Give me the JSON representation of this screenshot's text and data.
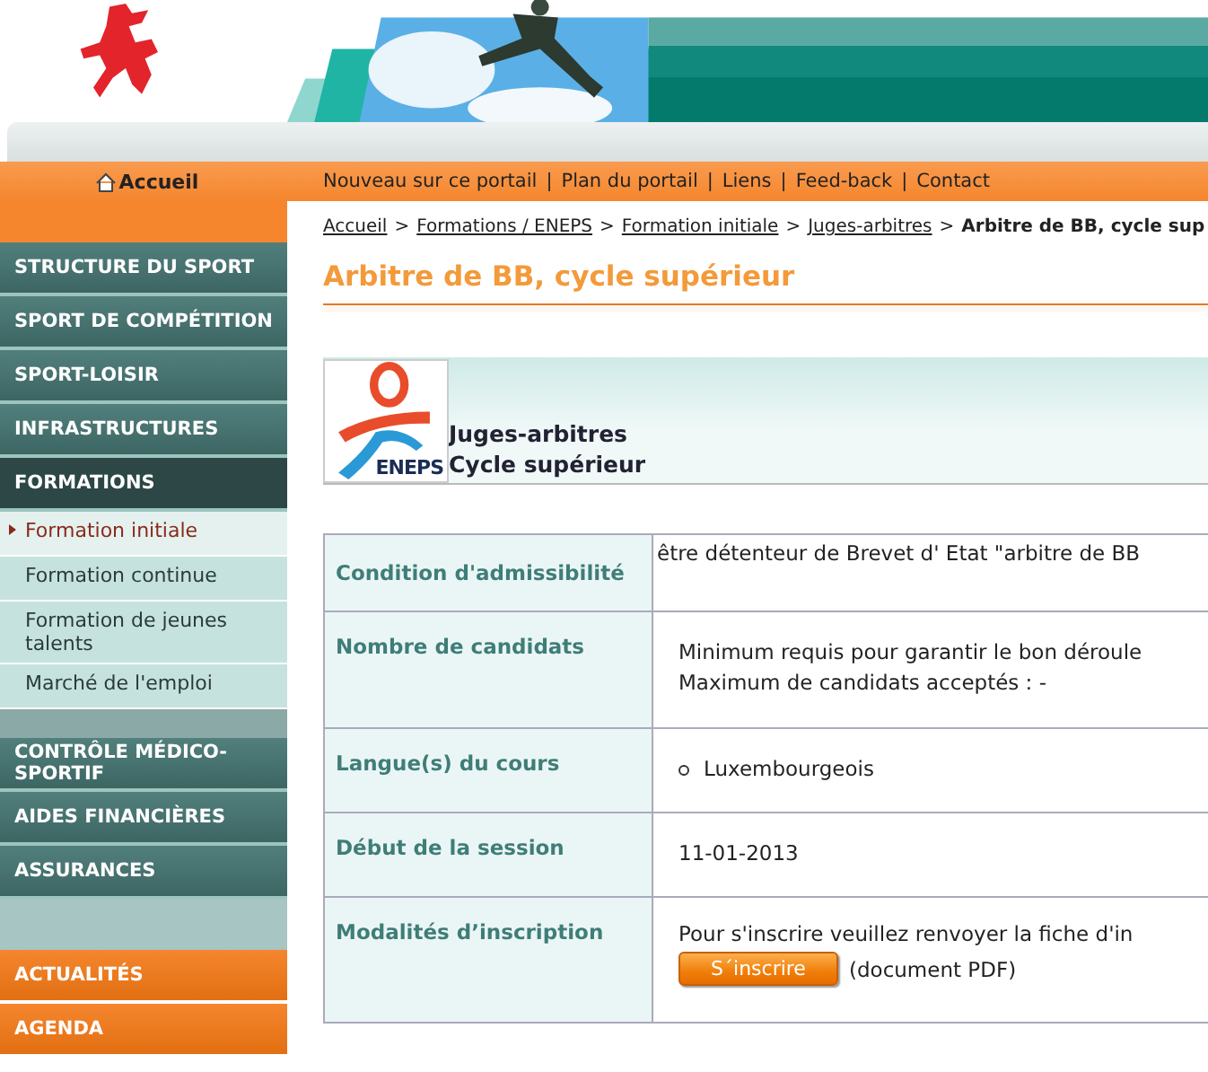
{
  "topnav": {
    "home": "Accueil",
    "links": [
      "Nouveau sur ce portail",
      "Plan du portail",
      "Liens",
      "Feed-back",
      "Contact"
    ],
    "separator": "|"
  },
  "sidebar": {
    "sections": [
      {
        "label": "STRUCTURE DU SPORT",
        "selected": false
      },
      {
        "label": "SPORT DE COMPÉTITION",
        "selected": false
      },
      {
        "label": "SPORT-LOISIR",
        "selected": false
      },
      {
        "label": "INFRASTRUCTURES",
        "selected": false
      },
      {
        "label": "FORMATIONS",
        "selected": true,
        "children": [
          {
            "label": "Formation initiale",
            "selected": true
          },
          {
            "label": "Formation continue",
            "selected": false
          },
          {
            "label": "Formation de jeunes talents",
            "selected": false
          },
          {
            "label": "Marché de l'emploi",
            "selected": false
          }
        ]
      }
    ],
    "sections2": [
      {
        "label": "CONTRÔLE MÉDICO-SPORTIF",
        "selected": false
      },
      {
        "label": "AIDES FINANCIÈRES",
        "selected": false
      },
      {
        "label": "ASSURANCES",
        "selected": false
      }
    ],
    "highlights": [
      "ACTUALITÉS",
      "AGENDA"
    ]
  },
  "breadcrumb": {
    "links": [
      "Accueil",
      "Formations / ENEPS",
      "Formation initiale",
      "Juges-arbitres"
    ],
    "current": "Arbitre de BB, cycle sup",
    "separator": ">"
  },
  "title": "Arbitre de BB, cycle supérieur",
  "course_box": {
    "logo_text": "ENEPS",
    "lines": [
      "Juges-arbitres",
      "Cycle supérieur"
    ]
  },
  "table": {
    "rows": [
      {
        "label": "Condition d'admissibilité",
        "kind": "top",
        "lines": [
          "être détenteur de Brevet d' Etat \"arbitre de BB"
        ]
      },
      {
        "label": "Nombre de candidats",
        "kind": "text",
        "lines": [
          "Minimum requis pour garantir le bon déroule",
          "Maximum de candidats acceptés : -"
        ]
      },
      {
        "label": "Langue(s) du cours",
        "kind": "list",
        "lines": [
          "Luxembourgeois"
        ]
      },
      {
        "label": "Début de la session",
        "kind": "text",
        "lines": [
          "11-01-2013"
        ]
      },
      {
        "label": "Modalités d’inscription",
        "kind": "signup",
        "lines": [
          "Pour s'inscrire veuillez renvoyer la fiche d'in"
        ],
        "button": "S´inscrire",
        "note": "(document PDF)"
      }
    ]
  }
}
